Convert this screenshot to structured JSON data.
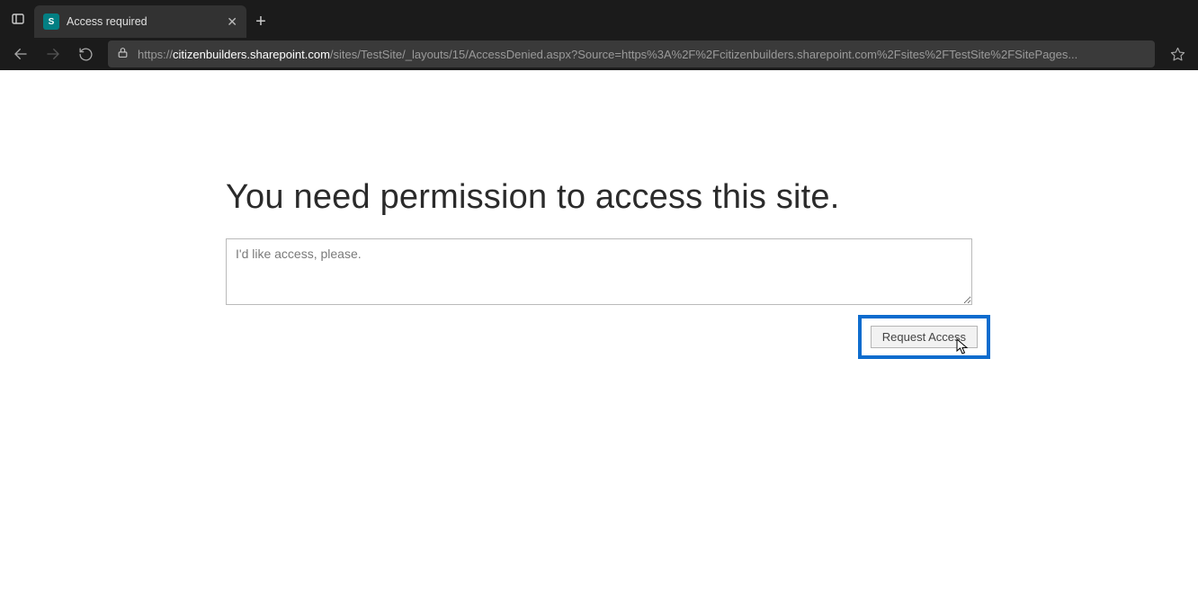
{
  "browser": {
    "tab": {
      "favicon_letter": "S",
      "title": "Access required"
    },
    "url": {
      "prefix": "https://",
      "host": "citizenbuilders.sharepoint.com",
      "path": "/sites/TestSite/_layouts/15/AccessDenied.aspx?Source=https%3A%2F%2Fcitizenbuilders.sharepoint.com%2Fsites%2FTestSite%2FSitePages..."
    }
  },
  "page": {
    "heading": "You need permission to access this site.",
    "textarea_placeholder": "I'd like access, please.",
    "request_button": "Request Access"
  }
}
